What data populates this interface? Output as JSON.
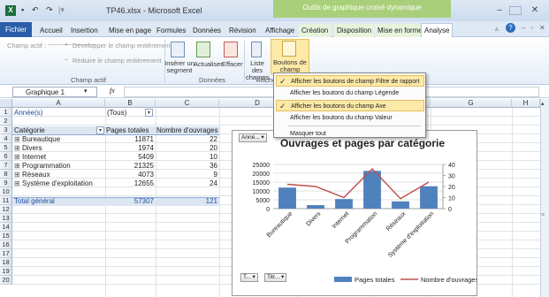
{
  "window": {
    "title": "TP46.xlsx - Microsoft Excel",
    "context_title": "Outils de graphique croisé dynamique",
    "app_icon": "X"
  },
  "tabs": [
    "Fichier",
    "Accueil",
    "Insertion",
    "Mise en page",
    "Formules",
    "Données",
    "Révision",
    "Affichage",
    "Création",
    "Disposition",
    "Mise en forme",
    "Analyse"
  ],
  "ribbon": {
    "active_field_label": "Champ actif :",
    "expand_label": "Développer le champ entièrement",
    "collapse_label": "Réduire le champ entièrement",
    "group_champ_actif": "Champ actif",
    "insert_segment": "Insérer un segment",
    "refresh": "Actualiser",
    "clear": "Effacer",
    "group_donnees": "Données",
    "field_list": "Liste des champs",
    "field_buttons": "Boutons de champ",
    "group_afficher": "Afficher"
  },
  "formula_bar": {
    "name_box": "Graphique 1",
    "fx": "fx",
    "formula": ""
  },
  "columns": [
    "A",
    "B",
    "C",
    "D",
    "E",
    "F",
    "G",
    "H"
  ],
  "rows": [
    "1",
    "2",
    "3",
    "4",
    "5",
    "6",
    "7",
    "8",
    "9",
    "10",
    "11",
    "12",
    "13",
    "14",
    "15",
    "16",
    "17",
    "18",
    "19",
    "20"
  ],
  "pivot": {
    "filter_label": "Année(s)",
    "filter_value": "(Tous)",
    "headers": [
      "Catégorie",
      "Pages totales",
      "Nombre d'ouvrages"
    ],
    "rows": [
      {
        "label": "Bureautique",
        "pages": "11871",
        "count": "22"
      },
      {
        "label": "Divers",
        "pages": "1974",
        "count": "20"
      },
      {
        "label": "Internet",
        "pages": "5409",
        "count": "10"
      },
      {
        "label": "Programmation",
        "pages": "21325",
        "count": "36"
      },
      {
        "label": "Réseaux",
        "pages": "4073",
        "count": "9"
      },
      {
        "label": "Système d'exploitation",
        "pages": "12655",
        "count": "24"
      }
    ],
    "total_label": "Total général",
    "total_pages": "57307",
    "total_count": "121"
  },
  "menu": {
    "items": [
      {
        "label": "Afficher les boutons de champ Filtre de rapport",
        "checked": true
      },
      {
        "label": "Afficher les boutons du champ Légende",
        "checked": false
      },
      {
        "label": "Afficher les boutons du champ Axe",
        "checked": true
      },
      {
        "label": "Afficher les boutons du champ Valeur",
        "checked": false
      },
      {
        "label": "Masquer tout",
        "checked": false
      }
    ]
  },
  "chart_field_buttons": {
    "report_filter": "Anné... ▾",
    "values_1": "T... ▾",
    "values_2": "Titr... ▾"
  },
  "chart_data": {
    "type": "bar",
    "title": "Ouvrages et pages par catégorie",
    "categories": [
      "Bureautique",
      "Divers",
      "Internet",
      "Programmation",
      "Réseaux",
      "Système d'exploitation"
    ],
    "series": [
      {
        "name": "Pages totales",
        "type": "bar",
        "axis": "left",
        "color": "#4f81bd",
        "values": [
          11871,
          1974,
          5409,
          21325,
          4073,
          12655
        ]
      },
      {
        "name": "Nombre d'ouvrages",
        "type": "line",
        "axis": "right",
        "color": "#c0504d",
        "values": [
          22,
          20,
          10,
          36,
          9,
          24
        ]
      }
    ],
    "y_left": {
      "min": 0,
      "max": 25000,
      "ticks": [
        "0",
        "5000",
        "10000",
        "15000",
        "20000",
        "25000"
      ]
    },
    "y_right": {
      "min": 0,
      "max": 40,
      "ticks": [
        "0",
        "10",
        "20",
        "30",
        "40"
      ]
    },
    "legend": "bottom"
  }
}
